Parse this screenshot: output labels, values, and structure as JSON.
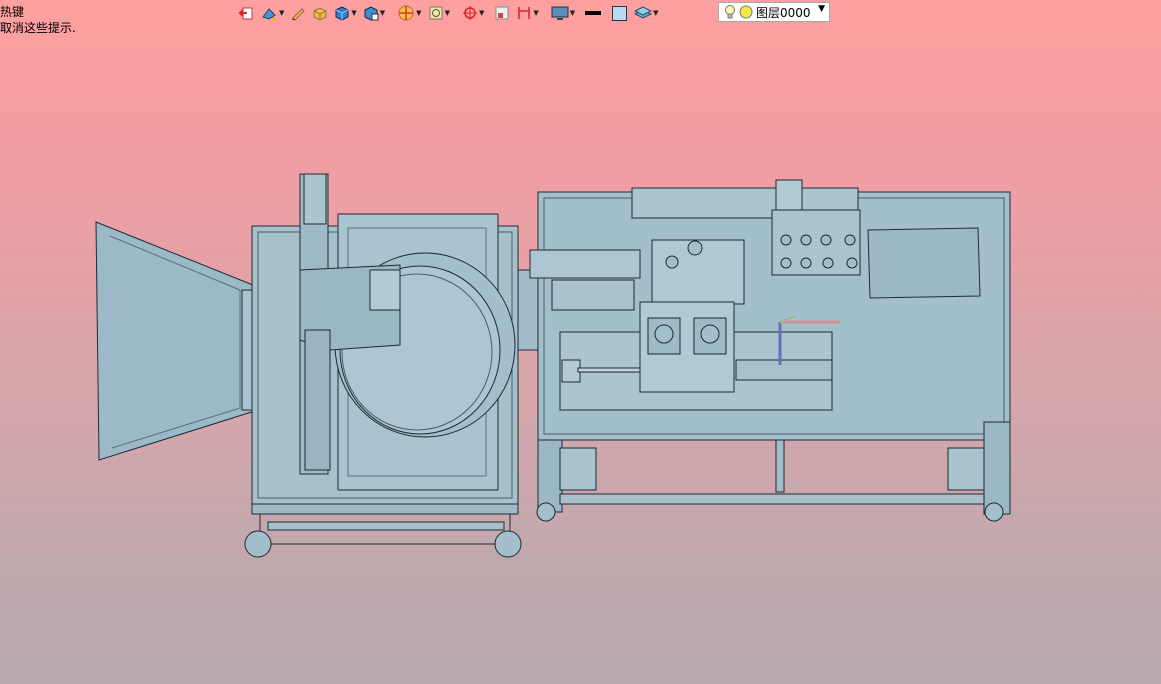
{
  "hint": {
    "line1": "热键",
    "line2": "取消这些提示."
  },
  "toolbar": {
    "layer_name": "图层0000",
    "line_color": "#000000",
    "fill_color": "#b6dcf5"
  },
  "viewport": {
    "background_top": "#ff9fa0",
    "background_bottom": "#b7a9ad",
    "model_color": "#a3bfcc"
  }
}
